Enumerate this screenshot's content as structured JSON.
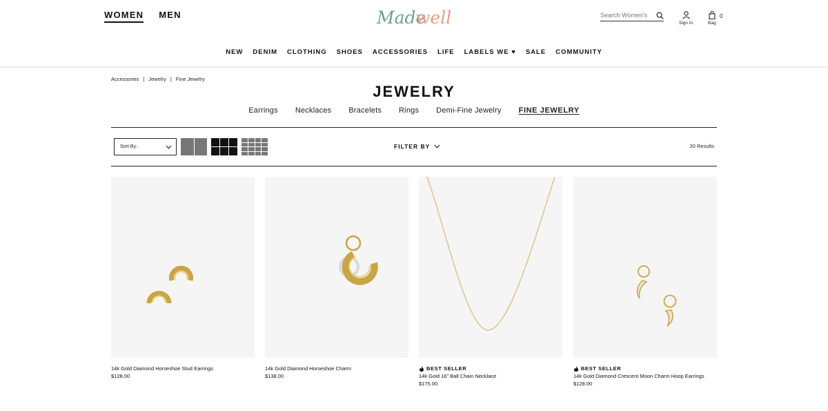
{
  "gender_nav": {
    "women": "WOMEN",
    "men": "MEN"
  },
  "logo": {
    "text": "Madewell",
    "color_top": "#6f9f93",
    "color_bottom": "#e79d84"
  },
  "search": {
    "placeholder": "Search Women's",
    "icon": "search-icon"
  },
  "account": {
    "sign_in_label": "Sign In",
    "bag_label": "Bag",
    "bag_count": "0"
  },
  "main_nav": {
    "items": [
      "NEW",
      "DENIM",
      "CLOTHING",
      "SHOES",
      "ACCESSORIES",
      "LIFE",
      "LABELS WE ♥",
      "SALE",
      "COMMUNITY"
    ]
  },
  "breadcrumb": {
    "items": [
      "Accessories",
      "Jewelry",
      "Fine Jewelry"
    ],
    "separator": "|"
  },
  "page": {
    "title": "JEWELRY"
  },
  "subnav": {
    "items": [
      "Earrings",
      "Necklaces",
      "Bracelets",
      "Rings",
      "Demi-Fine Jewelry",
      "FINE JEWELRY"
    ],
    "active": "FINE JEWELRY"
  },
  "toolbar": {
    "sort_label": "Sort By:",
    "filter_label": "FILTER BY",
    "results": "20 Results"
  },
  "products": [
    {
      "name": "14k Gold Diamond Horseshoe Stud Earrings",
      "price": "$128.00",
      "badge": ""
    },
    {
      "name": "14k Gold Diamond Horseshoe Charm",
      "price": "$138.00",
      "badge": ""
    },
    {
      "name": "14k Gold 16\" Ball Chain Necklace",
      "price": "$175.00",
      "badge": "BEST SELLER"
    },
    {
      "name": "14k Gold Diamond Crescent Moon Charm Hoop Earrings",
      "price": "$128.00",
      "badge": "BEST SELLER"
    }
  ],
  "colors": {
    "gold": "#c9a544",
    "image_bg": "#f5f5f5",
    "text": "#111111"
  }
}
